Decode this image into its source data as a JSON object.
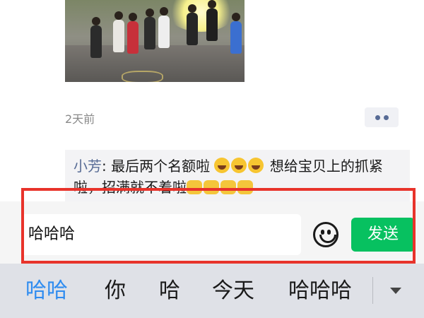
{
  "post": {
    "time": "2天前"
  },
  "comment": {
    "author": "小芳",
    "separator": ": ",
    "text_part1": "最后两个名额啦 ",
    "text_part2": "  想给宝贝上的抓紧啦，招满就不着啦",
    "emojis_smile": [
      "smiling-face-icon",
      "smiling-face-icon",
      "smiling-face-icon"
    ],
    "emojis_fist": [
      "fist-icon",
      "fist-icon",
      "fist-icon",
      "fist-icon"
    ]
  },
  "composer": {
    "input_value": "哈哈哈",
    "send_label": "发送",
    "emoji_icon": "smiley-face-icon"
  },
  "suggestions": {
    "items": [
      "哈哈",
      "你",
      "哈",
      "今天",
      "哈哈哈"
    ],
    "active_index": 0,
    "expand_icon": "caret-down-icon"
  },
  "colors": {
    "send_button": "#07c160",
    "link_name": "#576b95",
    "highlight_border": "#e8332b",
    "active_suggestion": "#2f8cf0"
  }
}
